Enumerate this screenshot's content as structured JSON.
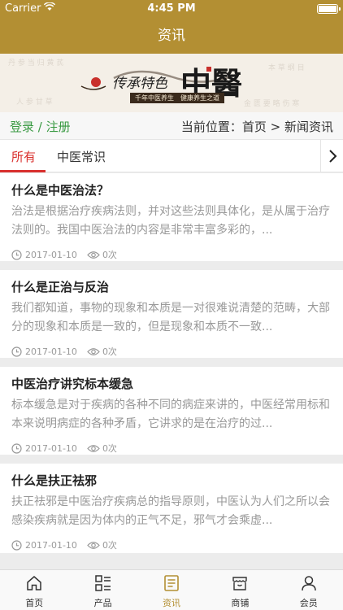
{
  "status_bar": {
    "carrier": "Carrier",
    "time": "4:45 PM"
  },
  "nav": {
    "title": "资讯"
  },
  "banner": {
    "text_left": "传承特色",
    "text_big": "中醫",
    "slogan": "千年中医养生　健康养生之道"
  },
  "breadcrumb": {
    "login": "登录 / 注册",
    "current": "当前位置：首页 > 新闻资讯"
  },
  "tabs": [
    {
      "label": "所有",
      "active": true
    },
    {
      "label": "中医常识",
      "active": false
    }
  ],
  "articles": [
    {
      "title": "什么是中医治法？",
      "summary": "治法是根据治疗疾病法则，并对这些法则具体化，是从属于治疗法则的。我国中医治法的内容是非常丰富多彩的，...",
      "date": "2017-01-10",
      "views": "0次"
    },
    {
      "title": "什么是正治与反治",
      "summary": "我们都知道，事物的现象和本质是一对很难说清楚的范畴，大部分的现象和本质是一致的，但是现象和本质不一致...",
      "date": "2017-01-10",
      "views": "0次"
    },
    {
      "title": "中医治疗讲究标本缓急",
      "summary": "标本缓急是对于疾病的各种不同的病症来讲的，中医经常用标和本来说明病症的各种矛盾，它讲求的是在治疗的过...",
      "date": "2017-01-10",
      "views": "0次"
    },
    {
      "title": "什么是扶正祛邪",
      "summary": "扶正祛邪是中医治疗疾病总的指导原则，中医认为人们之所以会感染疾病就是因为体内的正气不足，邪气才会乘虚...",
      "date": "2017-01-10",
      "views": "0次"
    }
  ],
  "tabbar": [
    {
      "label": "首页",
      "icon": "home-icon",
      "active": false
    },
    {
      "label": "产品",
      "icon": "grid-list-icon",
      "active": false
    },
    {
      "label": "资讯",
      "icon": "news-icon",
      "active": true
    },
    {
      "label": "商铺",
      "icon": "shop-icon",
      "active": false
    },
    {
      "label": "会员",
      "icon": "user-icon",
      "active": false
    }
  ],
  "colors": {
    "brand": "#b38f33",
    "tab_active": "#d9302e",
    "login_green": "#3a9a43"
  }
}
